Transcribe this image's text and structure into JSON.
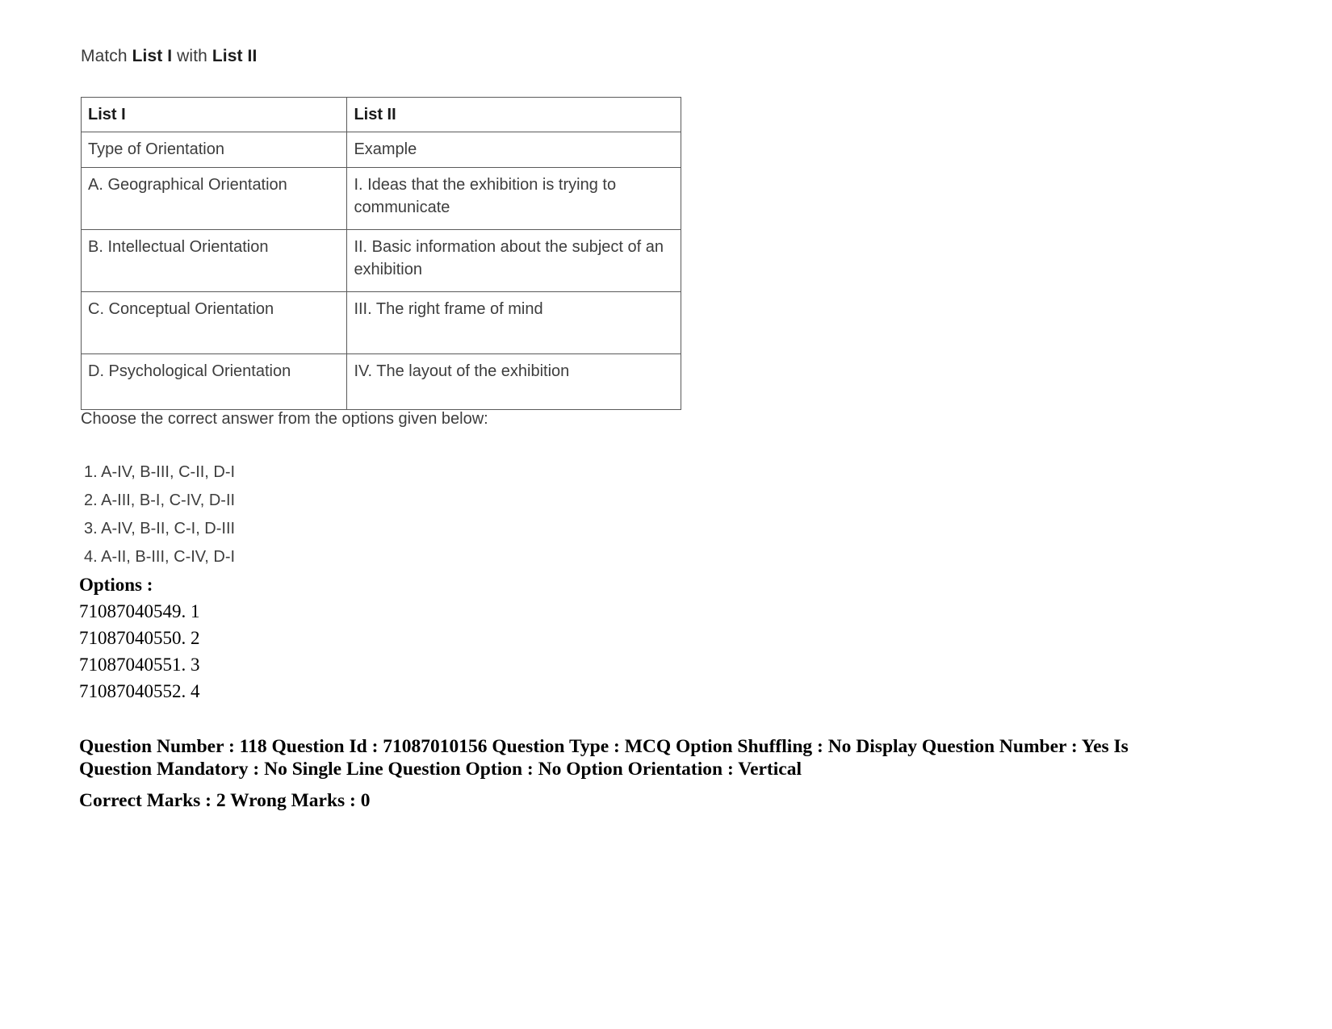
{
  "stem": {
    "prefix": "Match ",
    "bold1": "List I",
    "middle": " with ",
    "bold2": "List II"
  },
  "table": {
    "headers": [
      "List I",
      "List II"
    ],
    "subheaders": [
      "Type of Orientation",
      "Example"
    ],
    "rows": [
      {
        "left": "A. Geographical Orientation",
        "right": "I. Ideas that the exhibition is trying to communicate"
      },
      {
        "left": "B. Intellectual Orientation",
        "right": "II. Basic information about the subject of an exhibition"
      },
      {
        "left": "C. Conceptual Orientation",
        "right": "III. The right frame of mind"
      },
      {
        "left": "D. Psychological Orientation",
        "right": "IV. The layout of the exhibition"
      }
    ]
  },
  "prompt": "Choose the correct answer from the options given below:",
  "choices": [
    "1. A-IV, B-III, C-II, D-I",
    "2. A-III, B-I, C-IV, D-II",
    "3. A-IV, B-II, C-I, D-III",
    "4. A-II, B-III, C-IV, D-I"
  ],
  "options": {
    "title": "Options :",
    "rows": [
      "71087040549. 1",
      "71087040550. 2",
      "71087040551. 3",
      "71087040552. 4"
    ]
  },
  "meta": {
    "line1": "Question Number : 118 Question Id : 71087010156 Question Type : MCQ Option Shuffling : No Display Question Number : Yes Is Question Mandatory : No Single Line Question Option : No Option Orientation : Vertical",
    "marks": "Correct Marks : 2 Wrong Marks : 0"
  }
}
